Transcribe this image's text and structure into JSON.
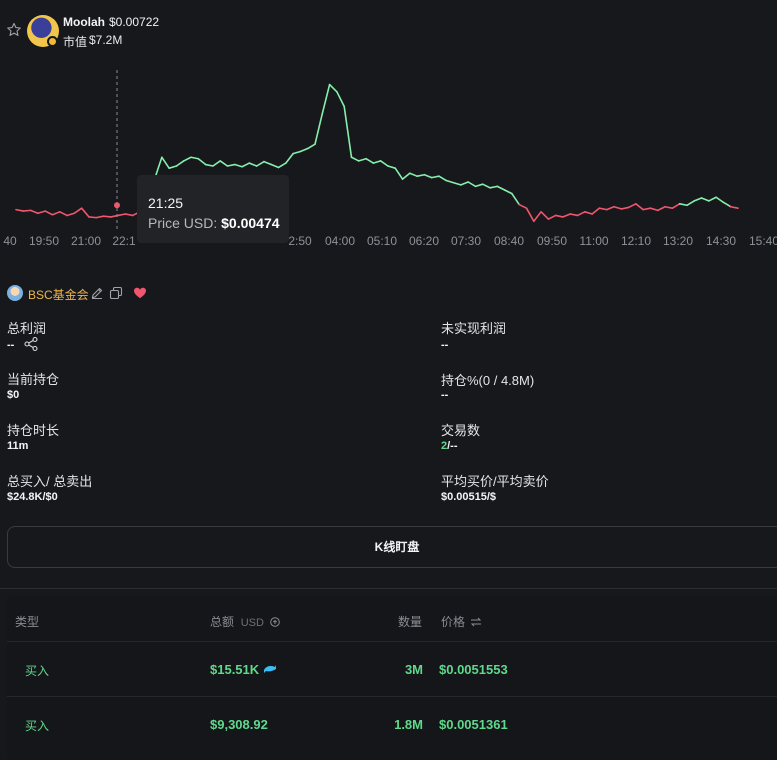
{
  "token": {
    "name": "Moolah",
    "price": "$0.00722",
    "market_cap_label": "市值",
    "market_cap": "$7.2M"
  },
  "chart_data": {
    "type": "line",
    "x_labels": [
      "40",
      "19:50",
      "21:00",
      "22:1",
      "2:50",
      "04:00",
      "05:10",
      "06:20",
      "07:30",
      "08:40",
      "09:50",
      "11:00",
      "12:10",
      "13:20",
      "14:30",
      "15:40"
    ],
    "series": [
      {
        "values": [
          0.00468,
          0.00466,
          0.00467,
          0.00463,
          0.00466,
          0.00461,
          0.00465,
          0.0046,
          0.00463,
          0.0047,
          0.00458,
          0.00457,
          0.00459,
          0.00458,
          0.0046,
          0.00462,
          0.0046,
          0.00465,
          0.00474,
          0.0051,
          0.0054,
          0.00525,
          0.00528,
          0.00535,
          0.0054,
          0.00538,
          0.0053,
          0.00528,
          0.00535,
          0.00528,
          0.0053,
          0.00527,
          0.00532,
          0.00528,
          0.00534,
          0.0053,
          0.00526,
          0.00532,
          0.00545,
          0.00548,
          0.00552,
          0.00558,
          0.006,
          0.0064,
          0.0063,
          0.0061,
          0.0054,
          0.00535,
          0.00538,
          0.00532,
          0.00535,
          0.00528,
          0.00525,
          0.0051,
          0.00518,
          0.00514,
          0.00516,
          0.00512,
          0.00514,
          0.00508,
          0.00505,
          0.00502,
          0.00506,
          0.005,
          0.00503,
          0.00498,
          0.005,
          0.00495,
          0.0049,
          0.00475,
          0.0047,
          0.00452,
          0.00465,
          0.00455,
          0.0046,
          0.00458,
          0.00462,
          0.0046,
          0.00465,
          0.00462,
          0.0047,
          0.00468,
          0.00472,
          0.00469,
          0.00471,
          0.00476,
          0.00468,
          0.0047,
          0.00467,
          0.00472,
          0.0047,
          0.00476,
          0.00474,
          0.0048,
          0.00484,
          0.0048,
          0.00485,
          0.00478,
          0.00472,
          0.0047
        ],
        "colors": {
          "up": "#86efac",
          "down": "#f0566e"
        }
      }
    ],
    "ylim": [
      0.0044,
      0.0066
    ],
    "hover": {
      "time": "21:25",
      "label": "Price USD:",
      "value": "$0.00474"
    }
  },
  "wallet": {
    "name": "BSC基金会",
    "icons": [
      "avatar",
      "edit-icon",
      "copy-icon",
      "heart-icon"
    ]
  },
  "stats": {
    "total_profit": {
      "label": "总利润",
      "value": "--"
    },
    "unrealized_profit": {
      "label": "未实现利润",
      "value": "--"
    },
    "current_holding": {
      "label": "当前持仓",
      "value": "$0"
    },
    "holding_pct": {
      "label": "持仓%(0 / 4.8M)",
      "value": "--"
    },
    "holding_duration": {
      "label": "持仓时长",
      "value": "11m"
    },
    "trades": {
      "label": "交易数",
      "value_green": "2",
      "value_rest": "/--"
    },
    "buy_sell": {
      "label": "总买入/ 总卖出",
      "value": "$24.8K/$0"
    },
    "avg_price": {
      "label": "平均买价/平均卖价",
      "value": "$0.00515/$"
    }
  },
  "kline_button": "K线盯盘",
  "table": {
    "headers": {
      "type": "类型",
      "amount": "总额",
      "unit": "USD",
      "qty": "数量",
      "price": "价格"
    },
    "rows": [
      {
        "type": "买入",
        "amount": "$15.51K",
        "qty": "3M",
        "price": "$0.0051553",
        "whale": true
      },
      {
        "type": "买入",
        "amount": "$9,308.92",
        "qty": "1.8M",
        "price": "$0.0051361",
        "whale": false
      }
    ]
  },
  "colors": {
    "background": "#17181c",
    "accent_green": "#5fd98c",
    "down_red": "#f0566e",
    "wallet_orange": "#f0b54a"
  }
}
